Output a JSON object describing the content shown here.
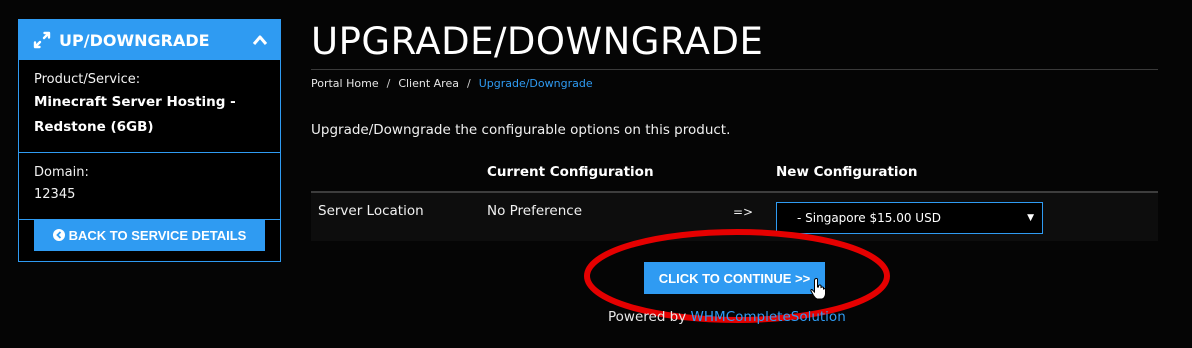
{
  "sidebar": {
    "title": "UP/DOWNGRADE",
    "product_label": "Product/Service:",
    "product_value": "Minecraft Server Hosting - Redstone (6GB)",
    "domain_label": "Domain:",
    "domain_value": "12345",
    "back_button": "BACK TO SERVICE DETAILS"
  },
  "header": {
    "title": "UPGRADE/DOWNGRADE",
    "breadcrumb": [
      "Portal Home",
      "Client Area",
      "Upgrade/Downgrade"
    ]
  },
  "main": {
    "intro": "Upgrade/Downgrade the configurable options on this product.",
    "columns": {
      "current": "Current Configuration",
      "new": "New Configuration"
    },
    "row": {
      "option": "Server Location",
      "current_value": "No Preference",
      "arrow": "=>",
      "new_value": "- Singapore $15.00 USD"
    },
    "continue_button": "CLICK TO CONTINUE >>"
  },
  "footer": {
    "powered_prefix": "Powered by",
    "powered_link": "WHMCompleteSolution"
  },
  "colors": {
    "accent": "#2f9bf2",
    "background": "#050505",
    "annotation_red": "#e50000"
  },
  "icons": [
    "expand-icon",
    "chevron-up-icon",
    "arrow-circle-left-icon",
    "hand-pointer-cursor-icon"
  ]
}
